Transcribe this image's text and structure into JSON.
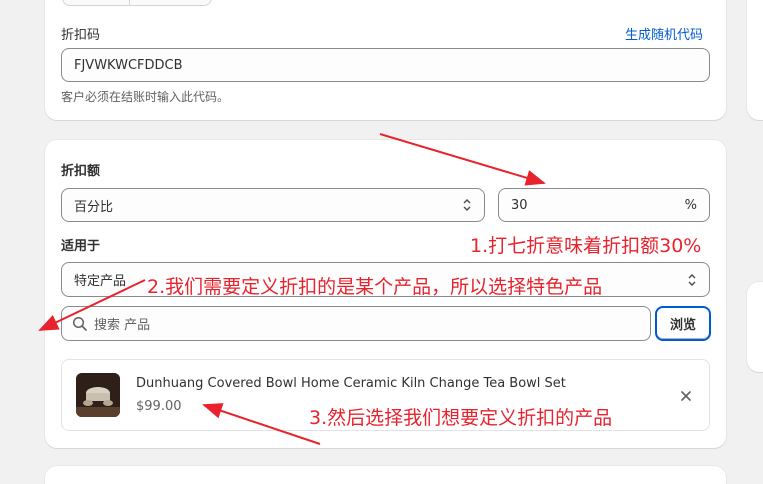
{
  "discount_code": {
    "label": "折扣码",
    "generate_link": "生成随机代码",
    "value": "FJVWKWCFDDCB",
    "help": "客户必须在结账时输入此代码。"
  },
  "discount_value": {
    "label": "折扣额",
    "type_selected": "百分比",
    "amount": "30",
    "unit": "%"
  },
  "applies_to": {
    "label": "适用于",
    "selected": "特定产品",
    "search_placeholder": "搜索 产品",
    "browse_label": "浏览"
  },
  "product": {
    "title": "Dunhuang Covered Bowl Home Ceramic Kiln Change Tea Bowl Set",
    "price": "$99.00"
  },
  "annotations": {
    "note1": "1.打七折意味着折扣额30%",
    "note2": "2.我们需要定义折扣的是某个产品，所以选择特色产品",
    "note3": "3.然后选择我们想要定义折扣的产品"
  },
  "colors": {
    "accent": "#005bd3",
    "annotation": "#e8232d"
  },
  "icons": [
    "search-icon",
    "chevron-updown-icon",
    "close-icon"
  ]
}
